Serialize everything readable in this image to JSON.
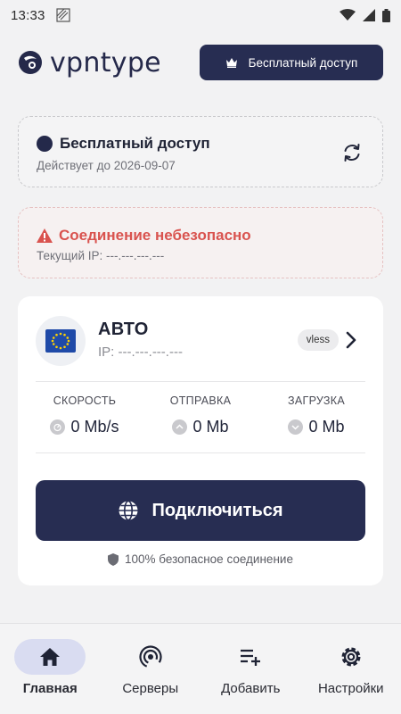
{
  "status_bar": {
    "time": "13:33"
  },
  "header": {
    "logo_text": "vpntype",
    "cta_label": "Бесплатный доступ"
  },
  "plan": {
    "title": "Бесплатный доступ",
    "valid_until": "Действует до 2026-09-07"
  },
  "warning": {
    "title": "Соединение небезопасно",
    "current_ip": "Текущий IP: ---.---.---.---"
  },
  "server": {
    "name": "АВТО",
    "ip": "IP: ---.---.---.---",
    "protocol": "vless",
    "flag": "eu-flag"
  },
  "stats": [
    {
      "label": "СКОРОСТЬ",
      "value": "0 Mb/s"
    },
    {
      "label": "ОТПРАВКА",
      "value": "0 Mb"
    },
    {
      "label": "ЗАГРУЗКА",
      "value": "0 Mb"
    }
  ],
  "connect": {
    "label": "Подключиться",
    "secure_note": "100% безопасное соединение"
  },
  "nav": [
    {
      "label": "Главная",
      "icon": "home-icon",
      "active": true
    },
    {
      "label": "Серверы",
      "icon": "servers-icon"
    },
    {
      "label": "Добавить",
      "icon": "add-list-icon"
    },
    {
      "label": "Настройки",
      "icon": "gear-icon"
    }
  ],
  "colors": {
    "primary": "#272d52",
    "danger": "#d9534f",
    "background": "#f2f2f3"
  }
}
